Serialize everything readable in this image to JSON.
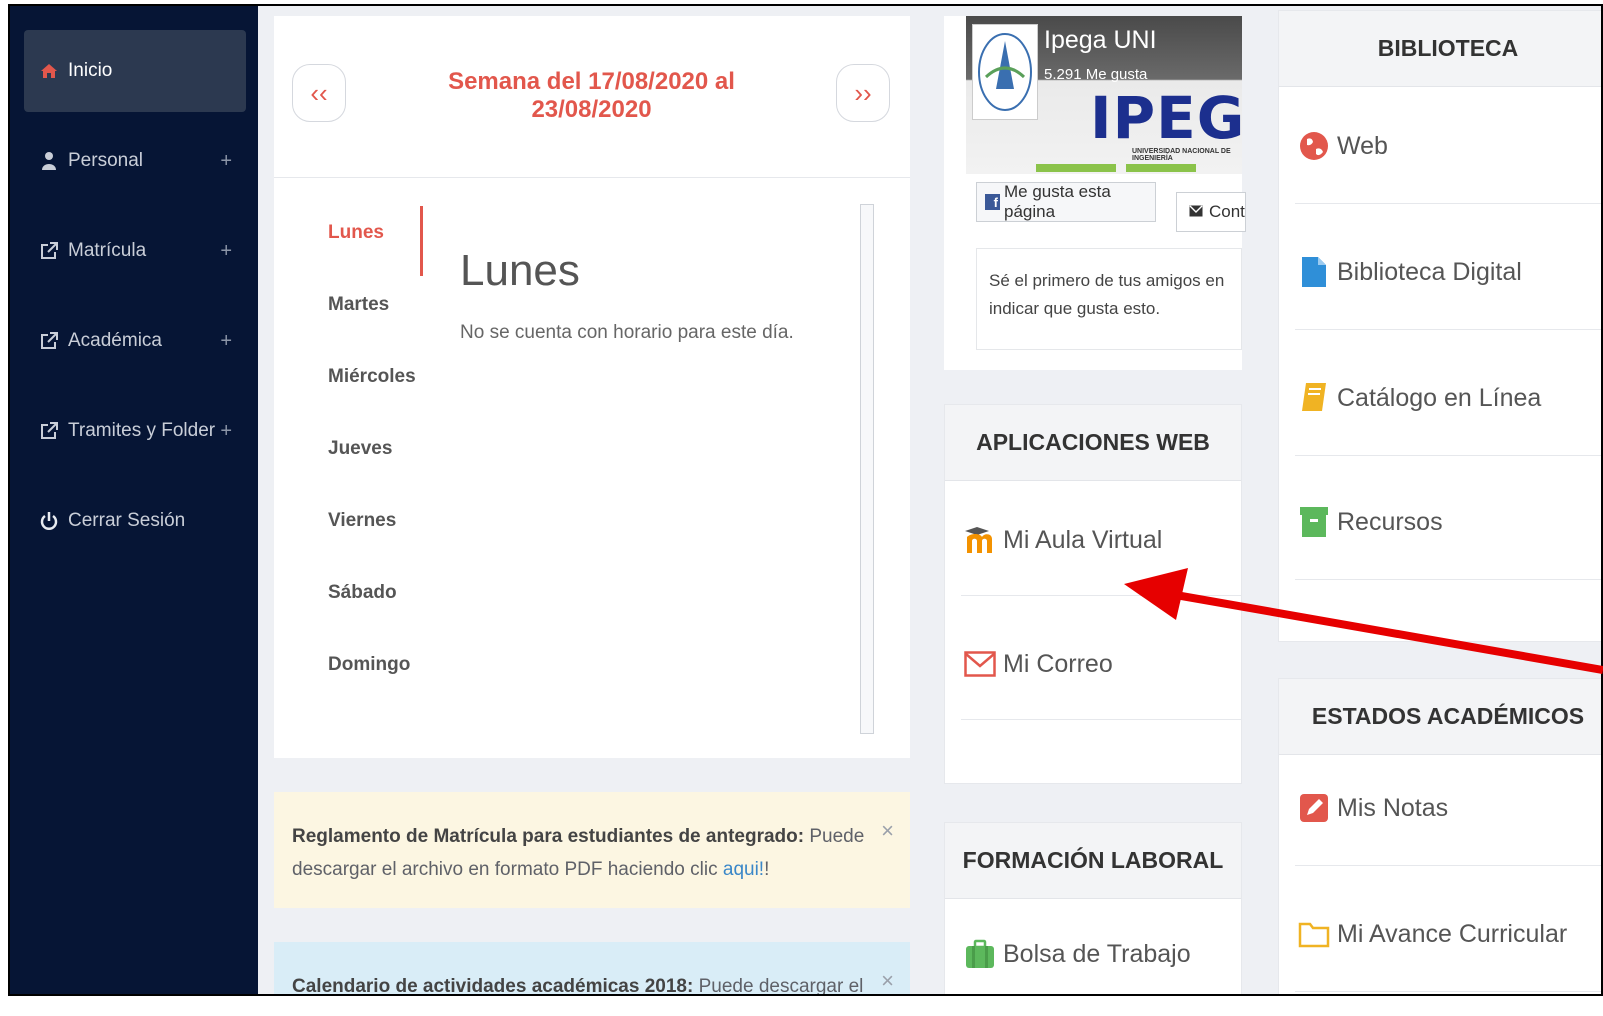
{
  "sidebar": {
    "items": [
      {
        "label": "Inicio",
        "icon": "home-icon",
        "expandable": false,
        "active": true
      },
      {
        "label": "Personal",
        "icon": "user-icon",
        "expandable": true
      },
      {
        "label": "Matrícula",
        "icon": "external-link-icon",
        "expandable": true
      },
      {
        "label": "Académica",
        "icon": "external-link-icon",
        "expandable": true
      },
      {
        "label": "Tramites y Folder",
        "icon": "external-link-icon",
        "expandable": true
      },
      {
        "label": "Cerrar Sesión",
        "icon": "power-icon",
        "expandable": false
      }
    ],
    "plus_symbol": "+"
  },
  "schedule": {
    "prev_symbol": "‹‹",
    "next_symbol": "››",
    "week_title": "Semana del 17/08/2020 al 23/08/2020",
    "days": [
      "Lunes",
      "Martes",
      "Miércoles",
      "Jueves",
      "Viernes",
      "Sábado",
      "Domingo"
    ],
    "selected_day": "Lunes",
    "message": "No se cuenta con horario para este día."
  },
  "alerts": {
    "reglamento": {
      "title": "Reglamento de Matrícula para estudiantes de antegrado:",
      "text": " Puede descargar el archivo en formato PDF haciendo clic ",
      "link": "aqui!",
      "end": "!"
    },
    "calendario": {
      "title": "Calendario de actividades académicas 2018:",
      "text": " Puede descargar el archivo en"
    },
    "close_symbol": "×"
  },
  "facebook": {
    "page_name": "Ipega UNI",
    "likes": "5.291 Me gusta",
    "brand": "IPEGA",
    "subtitle": "UNIVERSIDAD NACIONAL DE INGENIERÍA",
    "like_button": "Me gusta esta página",
    "contact_button": "Cont",
    "social_text": "Sé el primero de tus amigos en indicar que gusta esto."
  },
  "aplicaciones_web": {
    "title": "APLICACIONES WEB",
    "items": [
      {
        "label": "Mi Aula Virtual",
        "icon": "moodle-icon"
      },
      {
        "label": "Mi Correo",
        "icon": "mail-icon"
      }
    ]
  },
  "formacion_laboral": {
    "title": "FORMACIÓN LABORAL",
    "items": [
      {
        "label": "Bolsa de Trabajo",
        "icon": "briefcase-icon"
      }
    ]
  },
  "biblioteca": {
    "title": "BIBLIOTECA",
    "items": [
      {
        "label": "Web",
        "icon": "globe-icon"
      },
      {
        "label": "Biblioteca Digital",
        "icon": "file-icon"
      },
      {
        "label": "Catálogo en Línea",
        "icon": "book-icon"
      },
      {
        "label": "Recursos",
        "icon": "archive-icon"
      }
    ]
  },
  "estados_academicos": {
    "title": "ESTADOS ACADÉMICOS",
    "items": [
      {
        "label": "Mis Notas",
        "icon": "edit-icon"
      },
      {
        "label": "Mi Avance Curricular",
        "icon": "folder-icon"
      }
    ]
  },
  "colors": {
    "accent": "#e2574c",
    "sidebar_bg": "#061535",
    "annotation_arrow": "#e60000"
  }
}
